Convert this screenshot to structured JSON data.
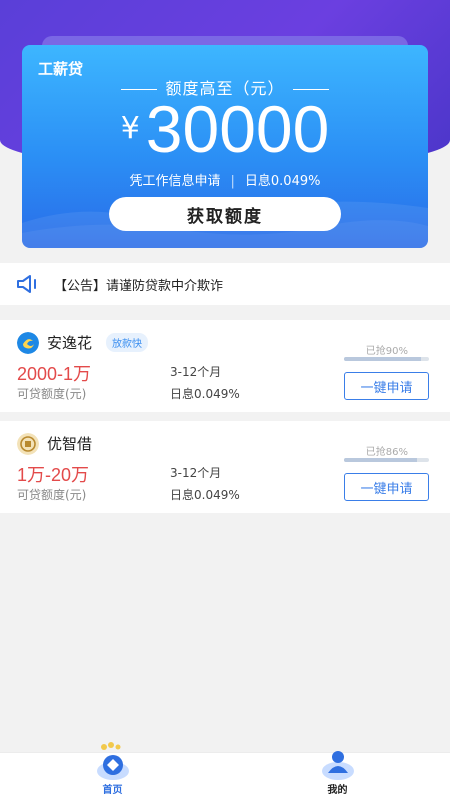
{
  "hero": {
    "brand": "工薪贷",
    "amount_label": "额度高至（元）",
    "currency": "¥",
    "amount": "30000",
    "sub_left": "凭工作信息申请",
    "sub_sep": "|",
    "sub_right": "日息0.049%",
    "cta_label": "获取额度"
  },
  "notice": {
    "text": "【公告】请谨防贷款中介欺诈",
    "icon": "speaker-icon"
  },
  "loans": [
    {
      "name": "安逸花",
      "tag": "放款快",
      "range": "2000-1万",
      "range_label": "可贷额度(元)",
      "term": "3-12个月",
      "rate": "日息0.049%",
      "grabbed_label": "已抢90%",
      "grabbed_pct": 90,
      "button": "一键申请"
    },
    {
      "name": "优智借",
      "tag": "",
      "range": "1万-20万",
      "range_label": "可贷额度(元)",
      "term": "3-12个月",
      "rate": "日息0.049%",
      "grabbed_label": "已抢86%",
      "grabbed_pct": 86,
      "button": "一键申请"
    }
  ],
  "tabbar": {
    "home": "首页",
    "mine": "我的"
  },
  "colors": {
    "accent": "#3a7ee8",
    "range_red": "#e34a4a",
    "hero_purple": "#5a3fd8"
  }
}
